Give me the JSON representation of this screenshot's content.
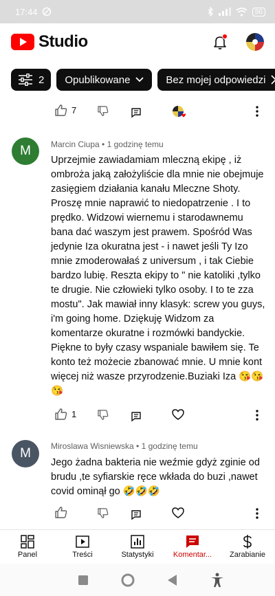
{
  "status_bar": {
    "time": "17:44",
    "battery": "50"
  },
  "header": {
    "app_name": "Studio"
  },
  "filters": {
    "filter_count": "2",
    "chips": [
      "Opublikowane",
      "Bez mojej odpowiedzi"
    ]
  },
  "previous_comment": {
    "likes": "7"
  },
  "comments": [
    {
      "avatar_letter": "M",
      "avatar_color": "#2e7d32",
      "author": "Marcin Ciupa",
      "time": "1 godzinę temu",
      "text": "Uprzejmie zawiadamiam mleczną ekipę , iż ombroża jaką założyliście dla mnie nie obejmuje zasięgiem działania kanału Mleczne Shoty. Proszę mnie  naprawić to niedopatrzenie . I to prędko. Widzowi wiernemu i starodawnemu bana dać waszym jest prawem. Spośród Was jedynie Iza okuratna jest - i nawet jeśli Ty Izo mnie zmoderowałaś z universum  , i tak Ciebie bardzo lubię. Reszta ekipy to \" nie katoliki ,tylko te drugie. Nie człowieki tylko osoby. I to te zza mostu\". Jak mawiał inny klasyk: screw you guys, i'm going home. Dziękuję Widzom za komentarze okuratne i rozmówki bandyckie. Piękne to były czasy  wspaniale bawiłem się. Te konto też możecie zbanować mnie.  U mnie kont więcej niż wasze przyrodzenie.Buziaki Iza 😘😘😘",
      "likes": "1"
    },
    {
      "avatar_letter": "M",
      "avatar_color": "#4a5563",
      "author": "Miroslawa Wisniewska",
      "time": "1 godzinę temu",
      "text": "Jego żadna bakteria nie weźmie gdyż zginie od brudu ,te syfiarskie ręce wkłada do buzi ,nawet covid ominął go 🤣🤣🤣",
      "likes": ""
    }
  ],
  "bottom_nav": [
    {
      "label": "Panel",
      "icon": "dashboard-icon"
    },
    {
      "label": "Treści",
      "icon": "content-icon"
    },
    {
      "label": "Statystyki",
      "icon": "analytics-icon"
    },
    {
      "label": "Komentar...",
      "icon": "comments-icon"
    },
    {
      "label": "Zarabianie",
      "icon": "earn-icon"
    }
  ],
  "colors": {
    "accent": "#ff0000",
    "active_nav": "#cc0000",
    "chip": "#0f0f0f"
  }
}
